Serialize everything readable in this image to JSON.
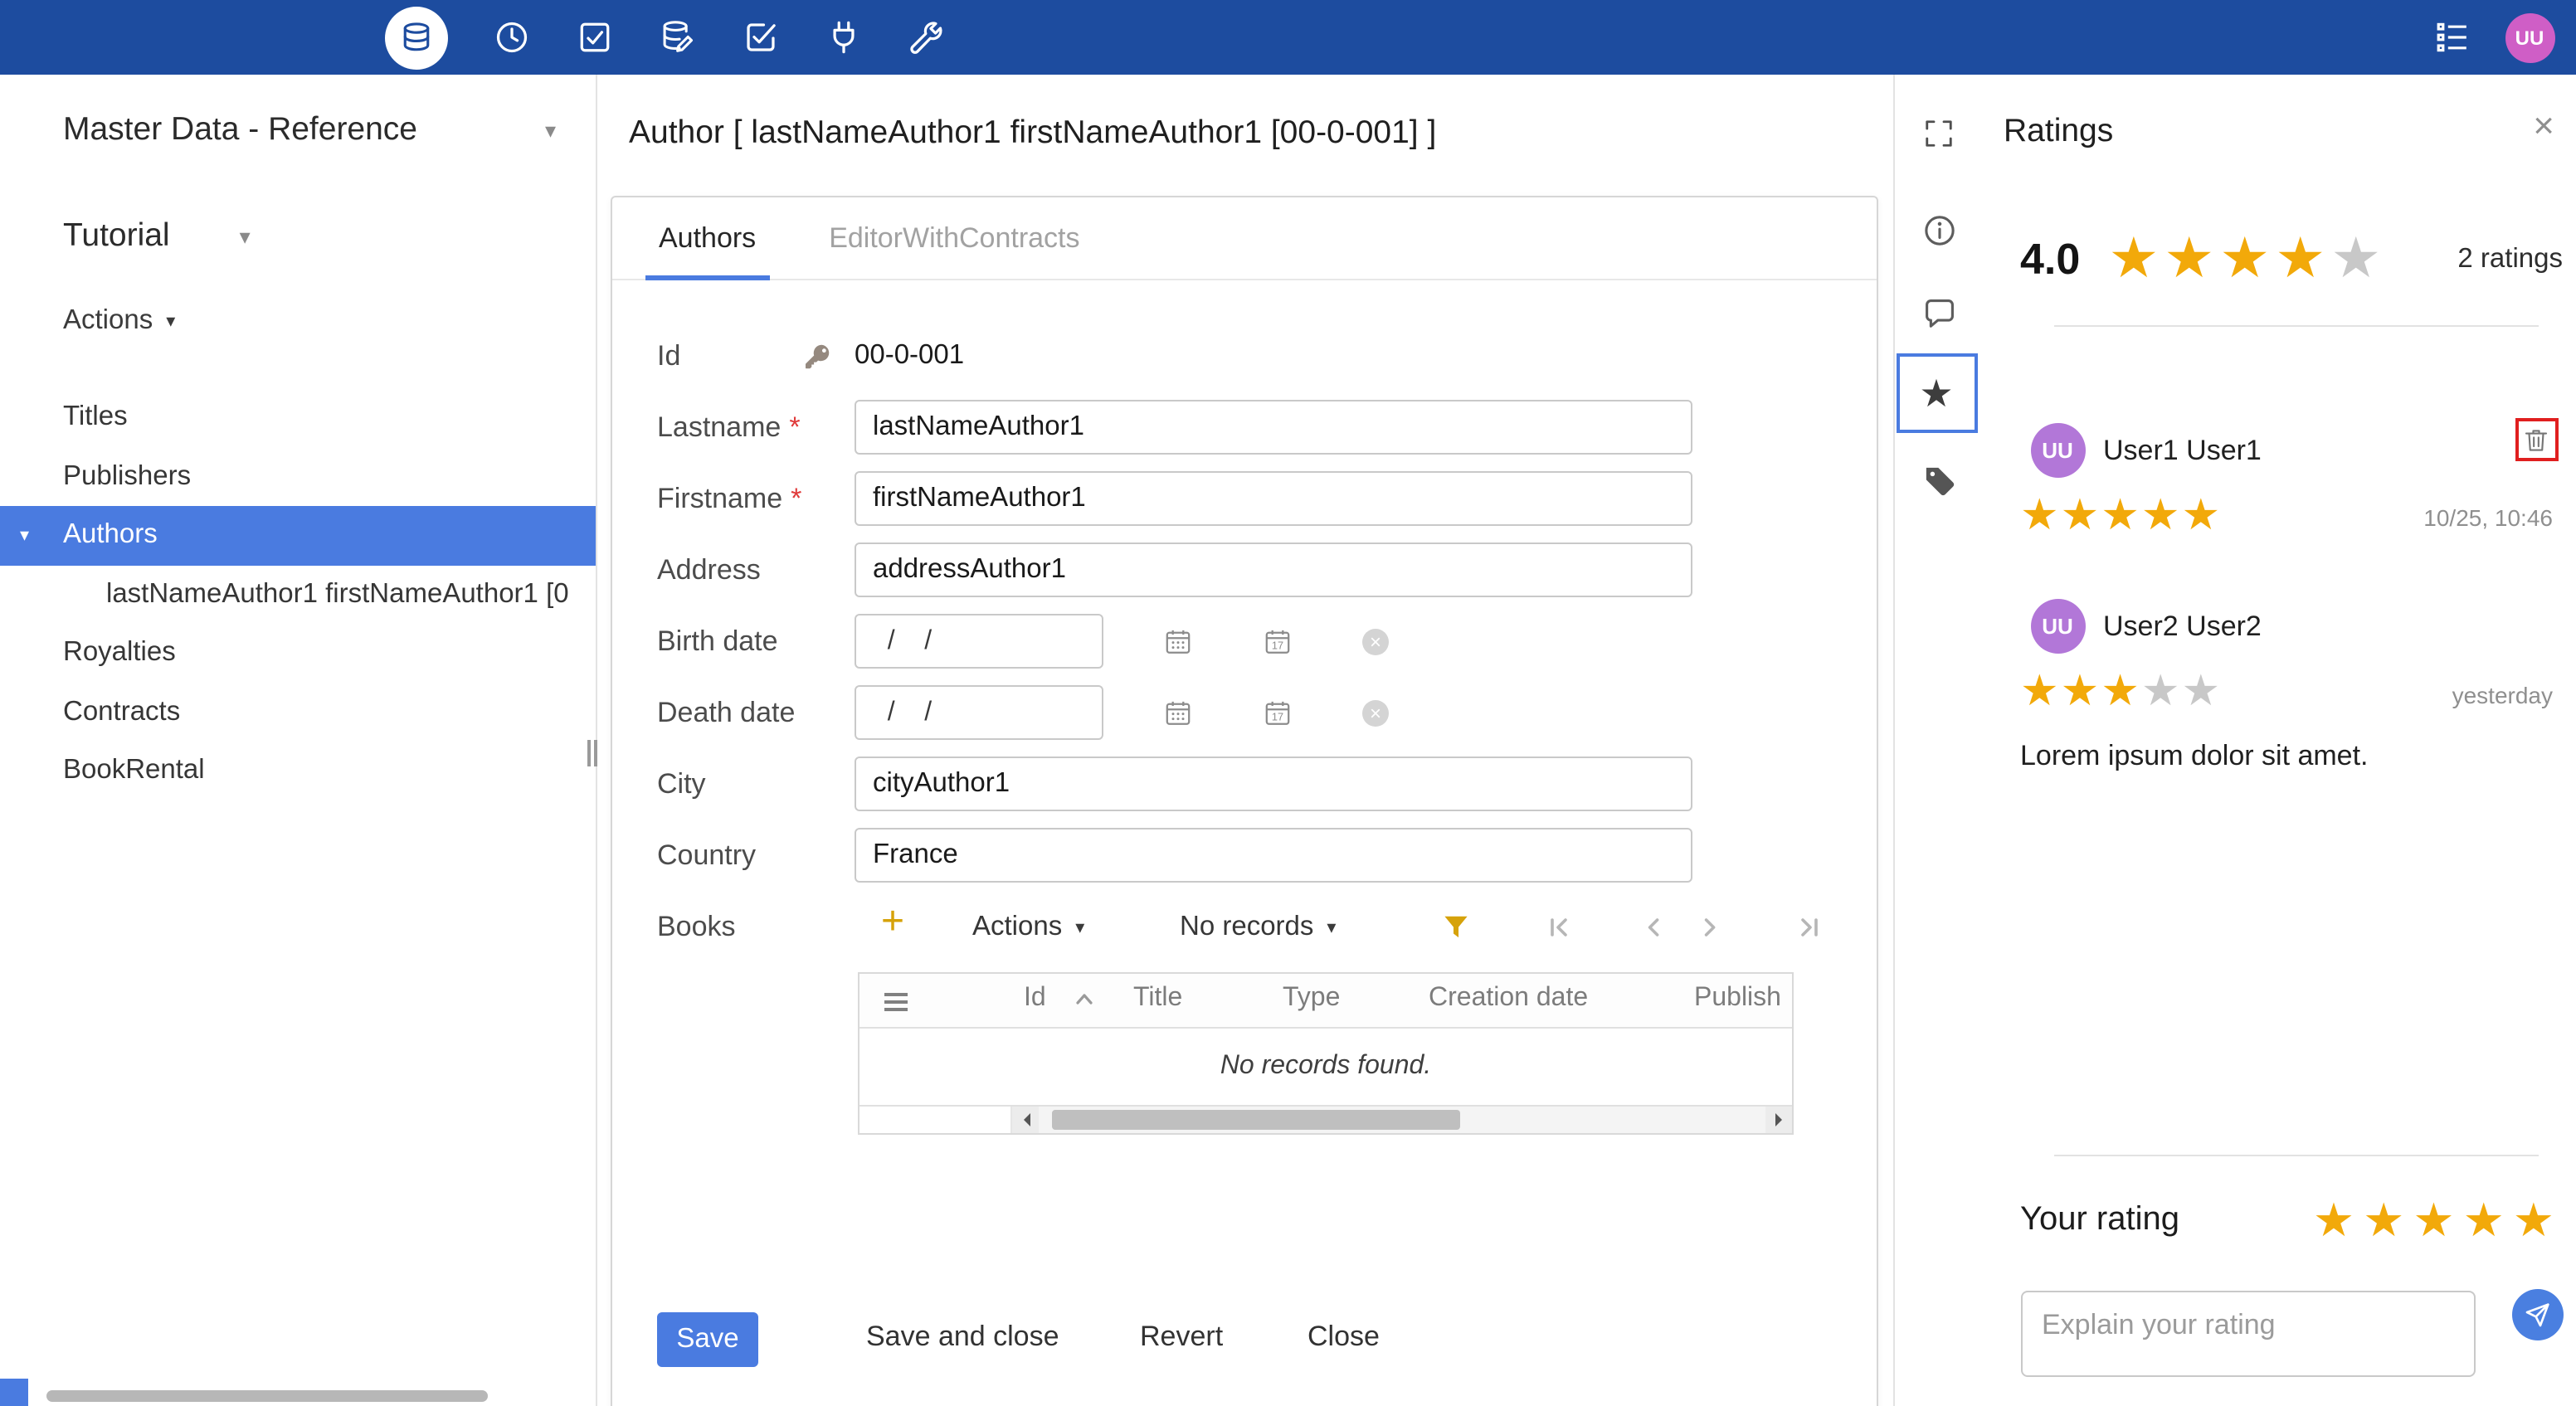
{
  "colors": {
    "topbar": "#1d4c9f",
    "accent": "#4a7be0",
    "star_gold": "#f2a90a"
  },
  "topbar": {
    "icons": [
      "database",
      "clock",
      "check-square",
      "database-edit",
      "check-square-edit",
      "plug",
      "wrench",
      "log"
    ],
    "avatar_initials": "UU"
  },
  "sidebar": {
    "app_title": "Master Data - Reference",
    "workspace": "Tutorial",
    "actions_label": "Actions",
    "items": [
      {
        "label": "Titles"
      },
      {
        "label": "Publishers"
      },
      {
        "label": "Authors",
        "selected": true
      },
      {
        "label": "lastNameAuthor1 firstNameAuthor1 [0",
        "child": true
      },
      {
        "label": "Royalties"
      },
      {
        "label": "Contracts"
      },
      {
        "label": "BookRental"
      }
    ]
  },
  "editor": {
    "title": "Author [ lastNameAuthor1 firstNameAuthor1 [00-0-001] ]",
    "tabs": [
      {
        "label": "Authors"
      },
      {
        "label": "EditorWithContracts"
      }
    ],
    "fields": [
      {
        "label": "Id",
        "value": "00-0-001"
      },
      {
        "label": "Lastname",
        "required": "*",
        "value": "lastNameAuthor1"
      },
      {
        "label": "Firstname",
        "required": "*",
        "value": "firstNameAuthor1"
      },
      {
        "label": "Address",
        "value": "addressAuthor1"
      },
      {
        "label": "Birth date",
        "value": "  /    /  "
      },
      {
        "label": "Death date",
        "value": "  /    /  "
      },
      {
        "label": "City",
        "value": "cityAuthor1"
      },
      {
        "label": "Country",
        "value": "France"
      }
    ],
    "books": {
      "label": "Books",
      "add_label": "+",
      "actions_label": "Actions",
      "paging_label": "No records",
      "columns": [
        "Id",
        "Title",
        "Type",
        "Creation date",
        "Publish"
      ],
      "empty_text": "No records found."
    },
    "buttons": {
      "save": "Save",
      "save_and_close": "Save and close",
      "revert": "Revert",
      "close": "Close"
    }
  },
  "ratings": {
    "title": "Ratings",
    "average": "4.0",
    "average_stars": 4,
    "count_label": "2 ratings",
    "reviews": [
      {
        "initials": "UU",
        "user": "User1 User1",
        "stars": 5,
        "time": "10/25, 10:46",
        "text": ""
      },
      {
        "initials": "UU",
        "user": "User2 User2",
        "stars": 3,
        "time": "yesterday",
        "text": "Lorem ipsum dolor sit amet."
      }
    ],
    "your_rating_label": "Your rating",
    "your_rating_stars": 5,
    "comment_placeholder": "Explain your rating"
  }
}
